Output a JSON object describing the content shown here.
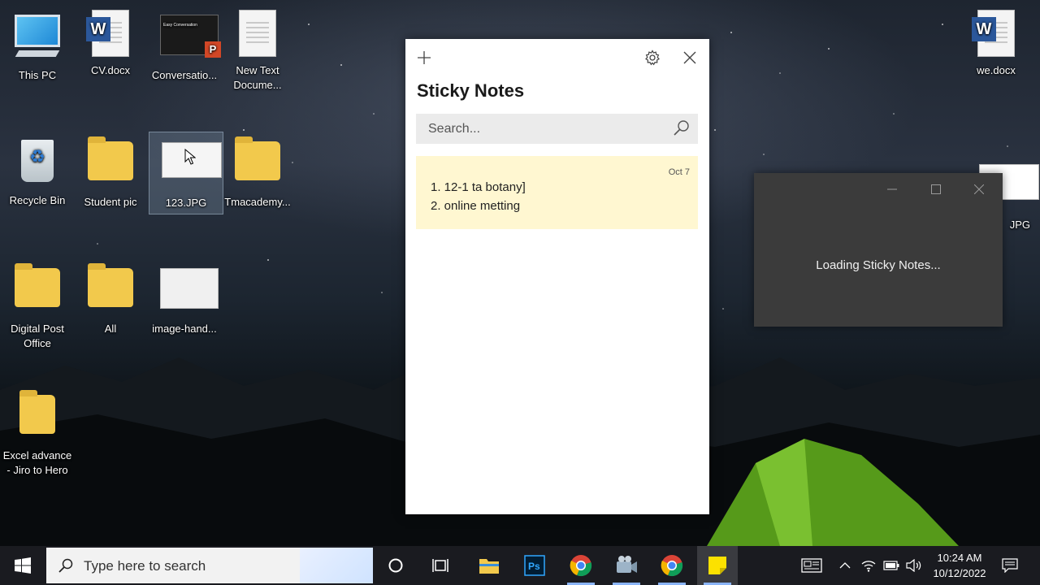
{
  "desktop": {
    "icons_left": [
      {
        "label_line1": "This PC",
        "label_line2": ""
      },
      {
        "label_line1": "CV.docx",
        "label_line2": ""
      },
      {
        "label_line1": "Conversatio...",
        "label_line2": ""
      },
      {
        "label_line1": "New Text",
        "label_line2": "Docume..."
      },
      {
        "label_line1": "Recycle Bin",
        "label_line2": ""
      },
      {
        "label_line1": "Student pic",
        "label_line2": ""
      },
      {
        "label_line1": "123.JPG",
        "label_line2": ""
      },
      {
        "label_line1": "Tmacademy...",
        "label_line2": ""
      },
      {
        "label_line1": "Digital Post",
        "label_line2": "Office"
      },
      {
        "label_line1": "All",
        "label_line2": ""
      },
      {
        "label_line1": "image-hand...",
        "label_line2": ""
      },
      {
        "label_line1": "Excel advance",
        "label_line2": "- Jiro to Hero"
      }
    ],
    "icons_right": [
      {
        "label": "we.docx"
      },
      {
        "label": "JPG"
      }
    ],
    "ppt_thumb_title": "Easy Conversation"
  },
  "sticky_notes": {
    "title": "Sticky Notes",
    "search_placeholder": "Search...",
    "note": {
      "date": "Oct 7",
      "lines": [
        "1. 12-1 ta botany]",
        "2. online metting"
      ]
    },
    "note_color": "#fff7d1"
  },
  "loading_window": {
    "text": "Loading Sticky Notes..."
  },
  "taskbar": {
    "search_placeholder": "Type here to search",
    "time": "10:24 AM",
    "date": "10/12/2022",
    "apps": [
      "start-icon",
      "cortana-icon",
      "task-view-icon",
      "file-explorer-icon",
      "photoshop-icon",
      "chrome-icon",
      "video-editor-icon",
      "chrome-icon",
      "sticky-notes-icon"
    ]
  }
}
